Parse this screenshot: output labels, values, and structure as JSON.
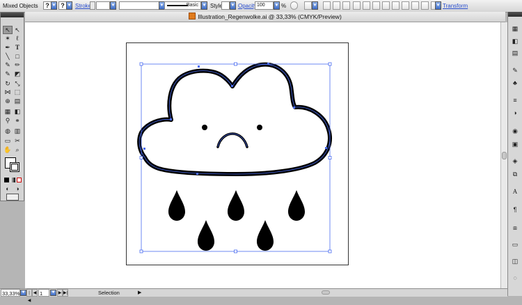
{
  "control_bar": {
    "selection_label": "Mixed Objects",
    "fill_unknown": "?",
    "stroke_unknown": "?",
    "stroke_label": "Stroke:",
    "brush_label": "Basic",
    "style_label": "Style:",
    "opacity_label": "Opacity:",
    "opacity_value": "100",
    "opacity_unit": "%",
    "transform_label": "Transform"
  },
  "document": {
    "title": "Illustration_Regenwolke.ai @ 33,33% (CMYK/Preview)"
  },
  "status_bar": {
    "zoom": "33,33%",
    "page": "1",
    "mode": "Selection"
  },
  "colors": {
    "selection_blue": "#4a6cf0",
    "artwork_black": "#000000",
    "ui_gray": "#d4d4d4"
  }
}
